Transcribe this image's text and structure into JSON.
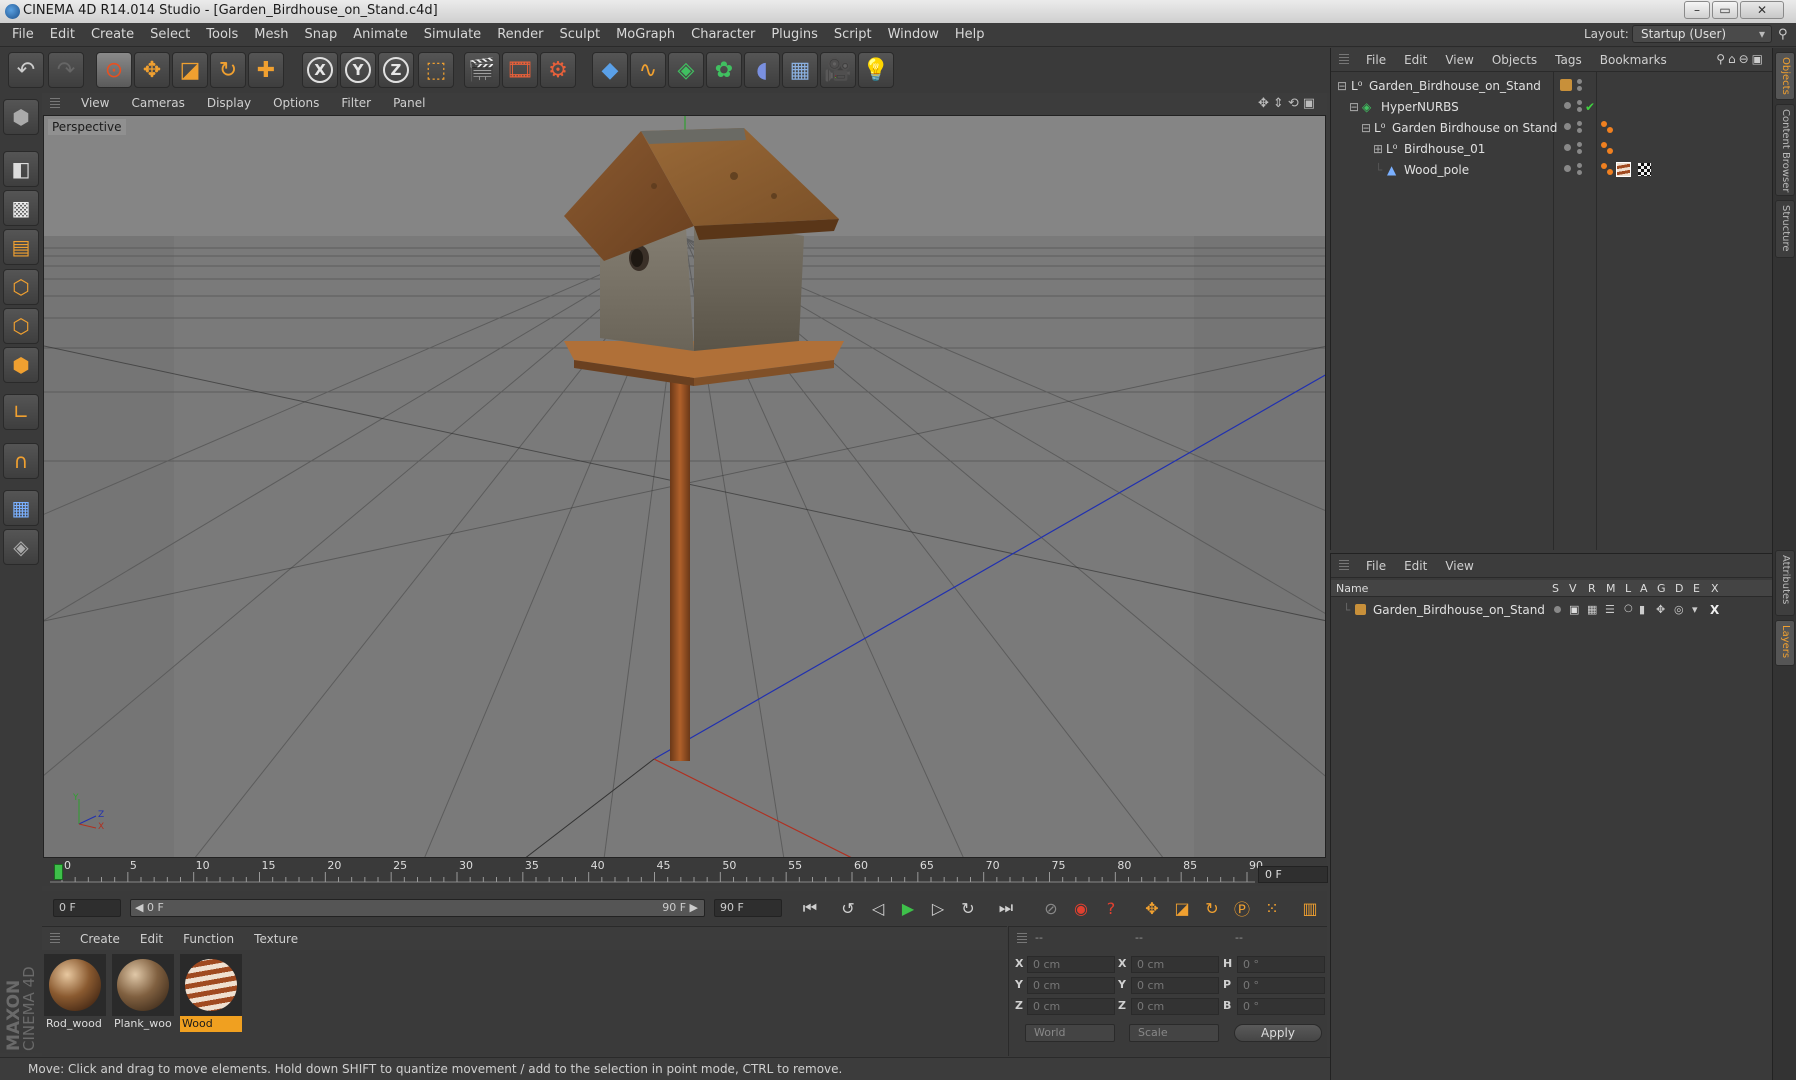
{
  "window": {
    "title": "CINEMA 4D R14.014 Studio - [Garden_Birdhouse_on_Stand.c4d]",
    "controls": [
      "–",
      "▭",
      "✕"
    ]
  },
  "menubar": {
    "items": [
      "File",
      "Edit",
      "Create",
      "Select",
      "Tools",
      "Mesh",
      "Snap",
      "Animate",
      "Simulate",
      "Render",
      "Sculpt",
      "MoGraph",
      "Character",
      "Plugins",
      "Script",
      "Window",
      "Help"
    ],
    "layout_label": "Layout:",
    "layout_value": "Startup (User)"
  },
  "toolbar": {
    "axis_x": "X",
    "axis_y": "Y",
    "axis_z": "Z"
  },
  "viewport": {
    "menu": [
      "View",
      "Cameras",
      "Display",
      "Options",
      "Filter",
      "Panel"
    ],
    "label": "Perspective",
    "gizmo": {
      "y": "Y",
      "z": "Z",
      "x": "X"
    }
  },
  "timeline": {
    "ticks": [
      "0",
      "5",
      "10",
      "15",
      "20",
      "25",
      "30",
      "35",
      "40",
      "45",
      "50",
      "55",
      "60",
      "65",
      "70",
      "75",
      "80",
      "85",
      "90"
    ],
    "current_frame": "0 F",
    "start_field": "0 F",
    "range_start": "◀ 0 F",
    "range_end": "90 F ▶",
    "end_field": "90 F"
  },
  "materials": {
    "menu": [
      "Create",
      "Edit",
      "Function",
      "Texture"
    ],
    "items": [
      {
        "label": "Rod_wood",
        "selected": false
      },
      {
        "label": "Plank_woo",
        "selected": false
      },
      {
        "label": "Wood",
        "selected": true
      }
    ]
  },
  "coordinates": {
    "header": [
      "--",
      "--",
      "--"
    ],
    "pos": [
      {
        "axis": "X",
        "value": "0 cm"
      },
      {
        "axis": "Y",
        "value": "0 cm"
      },
      {
        "axis": "Z",
        "value": "0 cm"
      }
    ],
    "size": [
      {
        "axis": "X",
        "value": "0 cm"
      },
      {
        "axis": "Y",
        "value": "0 cm"
      },
      {
        "axis": "Z",
        "value": "0 cm"
      }
    ],
    "rot": [
      {
        "axis": "H",
        "value": "0 °"
      },
      {
        "axis": "P",
        "value": "0 °"
      },
      {
        "axis": "B",
        "value": "0 °"
      }
    ],
    "mode_world": "World",
    "mode_scale": "Scale",
    "apply": "Apply"
  },
  "status": "Move: Click and drag to move elements. Hold down SHIFT to quantize movement / add to the selection in point mode, CTRL to remove.",
  "object_manager": {
    "menu": [
      "File",
      "Edit",
      "View",
      "Objects",
      "Tags",
      "Bookmarks"
    ],
    "objects": [
      {
        "name": "Garden_Birdhouse_on_Stand",
        "depth": 0
      },
      {
        "name": "HyperNURBS",
        "depth": 1
      },
      {
        "name": "Garden Birdhouse on Stand",
        "depth": 2
      },
      {
        "name": "Birdhouse_01",
        "depth": 3
      },
      {
        "name": "Wood_pole",
        "depth": 3
      }
    ]
  },
  "layer_manager": {
    "menu": [
      "File",
      "Edit",
      "View"
    ],
    "columns": [
      "Name",
      "S",
      "V",
      "R",
      "M",
      "L",
      "A",
      "G",
      "D",
      "E",
      "X"
    ],
    "layers": [
      {
        "name": "Garden_Birdhouse_on_Stand",
        "color": "#c8903a"
      }
    ]
  },
  "side_tabs": [
    "Objects",
    "Content Browser",
    "Structure",
    "Attributes",
    "Layers"
  ],
  "logo": {
    "line1": "MAXON",
    "line2": "CINEMA 4D"
  },
  "colors": {
    "accent": "#f0a020",
    "bg": "#3a3a3a"
  }
}
